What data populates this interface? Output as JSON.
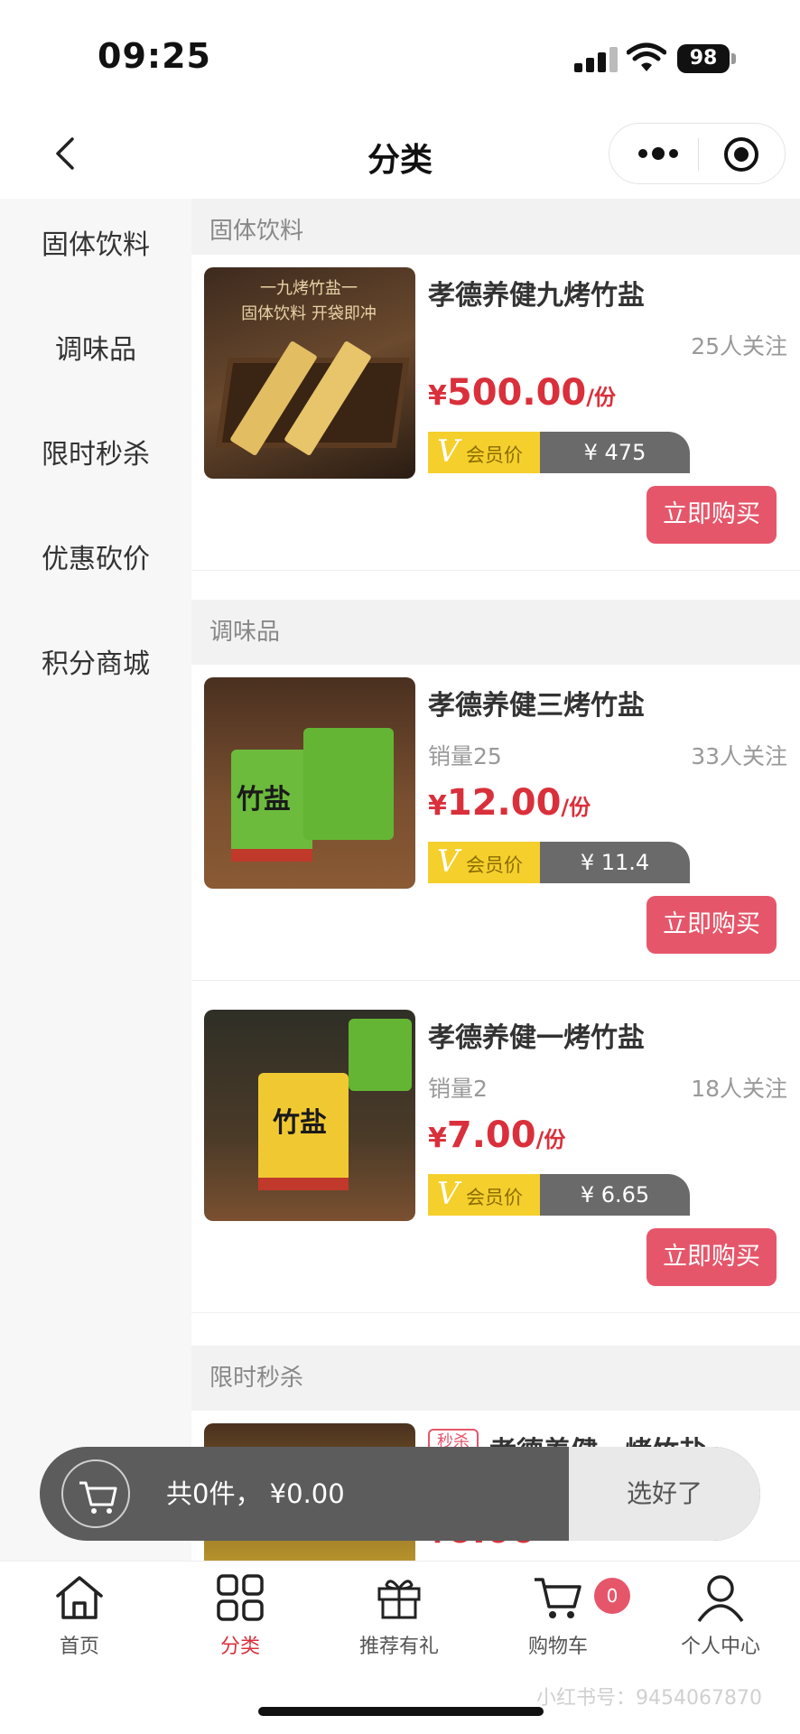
{
  "status_bar": {
    "time": "09:25",
    "battery": "98"
  },
  "nav": {
    "title": "分类"
  },
  "sidebar": {
    "items": [
      {
        "label": "固体饮料"
      },
      {
        "label": "调味品"
      },
      {
        "label": "限时秒杀"
      },
      {
        "label": "优惠砍价"
      },
      {
        "label": "积分商城"
      }
    ]
  },
  "sections": [
    {
      "title": "固体饮料",
      "products": [
        {
          "name": "孝德养健九烤竹盐",
          "sales": "",
          "followers": "25人关注",
          "currency": "¥",
          "price": "500.00",
          "unit": "/份",
          "member_label": "会员价",
          "member_price": "¥ 475",
          "buy_label": "立即购买",
          "thumb_text": "一九烤竹盐一\n固体饮料 开袋即冲"
        }
      ]
    },
    {
      "title": "调味品",
      "products": [
        {
          "name": "孝德养健三烤竹盐",
          "sales": "销量25",
          "followers": "33人关注",
          "currency": "¥",
          "price": "12.00",
          "unit": "/份",
          "member_label": "会员价",
          "member_price": "¥ 11.4",
          "buy_label": "立即购买",
          "thumb_text": "竹盐"
        },
        {
          "name": "孝德养健一烤竹盐",
          "sales": "销量2",
          "followers": "18人关注",
          "currency": "¥",
          "price": "7.00",
          "unit": "/份",
          "member_label": "会员价",
          "member_price": "¥ 6.65",
          "buy_label": "立即购买",
          "thumb_text": "竹盐"
        }
      ]
    },
    {
      "title": "限时秒杀",
      "products": [
        {
          "badge": "秒杀",
          "name": "孝德养健一烤竹盐",
          "currency": "¥",
          "price": "6.00"
        }
      ]
    }
  ],
  "cart_bar": {
    "summary": "共0件， ¥0.00",
    "confirm_label": "选好了"
  },
  "tabbar": {
    "items": [
      {
        "label": "首页",
        "icon": "home-icon"
      },
      {
        "label": "分类",
        "icon": "grid-icon",
        "active": true
      },
      {
        "label": "推荐有礼",
        "icon": "gift-icon"
      },
      {
        "label": "购物车",
        "icon": "cart-icon",
        "badge": "0"
      },
      {
        "label": "个人中心",
        "icon": "user-icon"
      }
    ]
  },
  "watermark": "小红书号：9454067870",
  "colors": {
    "accent": "#d9303b",
    "button": "#e6566a",
    "member_yellow": "#f5cf2c",
    "member_gray": "#6a6a6a"
  }
}
